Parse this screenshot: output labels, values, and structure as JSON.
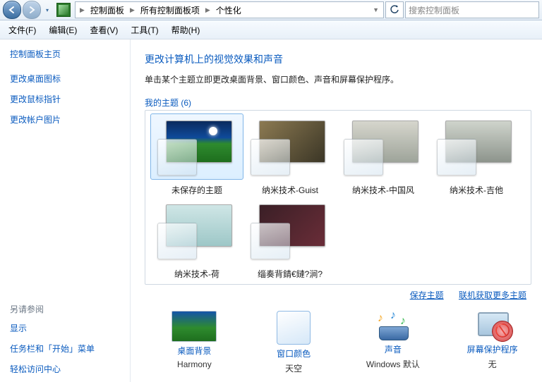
{
  "toolbar": {
    "breadcrumb": [
      "控制面板",
      "所有控制面板项",
      "个性化"
    ],
    "refresh_dd": "▼",
    "search_placeholder": "搜索控制面板"
  },
  "menus": [
    "文件(F)",
    "编辑(E)",
    "查看(V)",
    "工具(T)",
    "帮助(H)"
  ],
  "sidebar": {
    "home": "控制面板主页",
    "links": [
      "更改桌面图标",
      "更改鼠标指针",
      "更改帐户图片"
    ],
    "see_also_hdr": "另请参阅",
    "see_also": [
      "显示",
      "任务栏和「开始」菜单",
      "轻松访问中心"
    ]
  },
  "main": {
    "heading": "更改计算机上的视觉效果和声音",
    "desc": "单击某个主题立即更改桌面背景、窗口颜色、声音和屏幕保护程序。",
    "group_label": "我的主题 (6)",
    "themes": [
      {
        "name": "未保存的主题"
      },
      {
        "name": "纳米技术-Guist"
      },
      {
        "name": "纳米技术-中国风"
      },
      {
        "name": "纳米技术-吉他"
      },
      {
        "name": "纳米技术-荷"
      },
      {
        "name": "缁奏背錆€鏈?涧?"
      }
    ],
    "save_theme": "保存主题",
    "get_more": "联机获取更多主题"
  },
  "bottom": {
    "bg_label": "桌面背景",
    "bg_value": "Harmony",
    "wc_label": "窗口颜色",
    "wc_value": "天空",
    "sound_label": "声音",
    "sound_value": "Windows 默认",
    "ss_label": "屏幕保护程序",
    "ss_value": "无"
  }
}
